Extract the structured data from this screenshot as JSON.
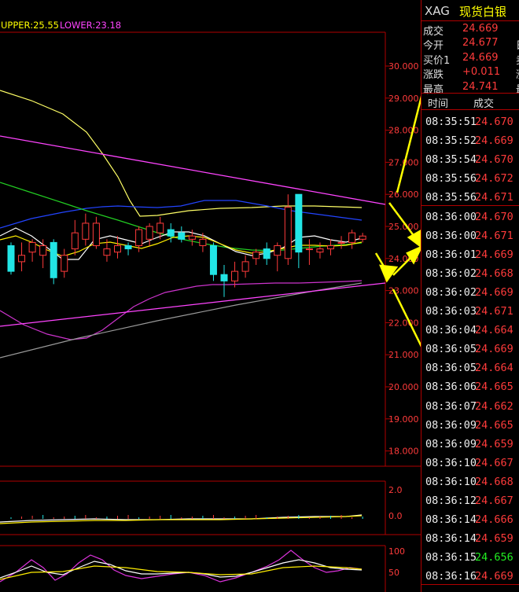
{
  "indicator_legend": {
    "upper": "UPPER:25.55",
    "lower": "LOWER:23.18"
  },
  "price_axis": [
    "30.000",
    "29.000",
    "28.000",
    "27.000",
    "26.000",
    "25.000",
    "24.000",
    "23.000",
    "22.000",
    "21.000",
    "20.000",
    "19.000",
    "18.000"
  ],
  "sub1_axis": [
    "2.0",
    "0.0"
  ],
  "sub2_axis": [
    "100",
    "50"
  ],
  "header": {
    "code": "XAG",
    "name": "现货白银"
  },
  "quote_rows": [
    {
      "label": "成交",
      "value": "24.669",
      "extra": ""
    },
    {
      "label": "今开",
      "value": "24.677",
      "extra": "日"
    },
    {
      "label": "买价1",
      "value": "24.669",
      "extra": "卖"
    },
    {
      "label": "涨跌",
      "value": "+0.011",
      "extra": "涨"
    },
    {
      "label": "最高",
      "value": "24.741",
      "extra": "最"
    }
  ],
  "tick_header": {
    "time": "时间",
    "price": "成交"
  },
  "ticks": [
    {
      "time": "08:35:51",
      "price": "24.670",
      "color": "red"
    },
    {
      "time": "08:35:52",
      "price": "24.669",
      "color": "red"
    },
    {
      "time": "08:35:54",
      "price": "24.670",
      "color": "red"
    },
    {
      "time": "08:35:56",
      "price": "24.672",
      "color": "red"
    },
    {
      "time": "08:35:56",
      "price": "24.671",
      "color": "red"
    },
    {
      "time": "08:36:00",
      "price": "24.670",
      "color": "red"
    },
    {
      "time": "08:36:00",
      "price": "24.671",
      "color": "red"
    },
    {
      "time": "08:36:01",
      "price": "24.669",
      "color": "red"
    },
    {
      "time": "08:36:02",
      "price": "24.668",
      "color": "red"
    },
    {
      "time": "08:36:02",
      "price": "24.669",
      "color": "red"
    },
    {
      "time": "08:36:03",
      "price": "24.671",
      "color": "red"
    },
    {
      "time": "08:36:04",
      "price": "24.664",
      "color": "red"
    },
    {
      "time": "08:36:05",
      "price": "24.669",
      "color": "red"
    },
    {
      "time": "08:36:05",
      "price": "24.664",
      "color": "red"
    },
    {
      "time": "08:36:06",
      "price": "24.665",
      "color": "red"
    },
    {
      "time": "08:36:07",
      "price": "24.662",
      "color": "red"
    },
    {
      "time": "08:36:09",
      "price": "24.665",
      "color": "red"
    },
    {
      "time": "08:36:09",
      "price": "24.659",
      "color": "red"
    },
    {
      "time": "08:36:10",
      "price": "24.667",
      "color": "red"
    },
    {
      "time": "08:36:10",
      "price": "24.668",
      "color": "red"
    },
    {
      "time": "08:36:12",
      "price": "24.667",
      "color": "red"
    },
    {
      "time": "08:36:14",
      "price": "24.666",
      "color": "red"
    },
    {
      "time": "08:36:14",
      "price": "24.659",
      "color": "red"
    },
    {
      "time": "08:36:15",
      "price": "24.656",
      "color": "green"
    },
    {
      "time": "08:36:16",
      "price": "24.669",
      "color": "red"
    }
  ],
  "chart_data": {
    "type": "candlestick",
    "y_range": [
      17.5,
      30.5
    ],
    "candles": [
      {
        "o": 23.6,
        "c": 24.4,
        "h": 24.5,
        "l": 23.5,
        "up": false
      },
      {
        "o": 23.9,
        "c": 24.1,
        "h": 24.5,
        "l": 23.6,
        "up": true
      },
      {
        "o": 24.2,
        "c": 24.5,
        "h": 24.6,
        "l": 23.9,
        "up": true
      },
      {
        "o": 24.1,
        "c": 24.4,
        "h": 24.6,
        "l": 23.7,
        "up": true
      },
      {
        "o": 23.4,
        "c": 24.5,
        "h": 24.6,
        "l": 23.2,
        "up": false
      },
      {
        "o": 23.6,
        "c": 24.1,
        "h": 24.3,
        "l": 23.4,
        "up": true
      },
      {
        "o": 24.3,
        "c": 24.8,
        "h": 25.2,
        "l": 24.1,
        "up": true
      },
      {
        "o": 24.6,
        "c": 25.1,
        "h": 25.4,
        "l": 24.4,
        "up": true
      },
      {
        "o": 25.1,
        "c": 24.4,
        "h": 25.3,
        "l": 24.3,
        "up": true
      },
      {
        "o": 24.3,
        "c": 24.1,
        "h": 24.6,
        "l": 23.9,
        "up": true
      },
      {
        "o": 24.4,
        "c": 24.2,
        "h": 24.7,
        "l": 24.0,
        "up": true
      },
      {
        "o": 24.3,
        "c": 24.4,
        "h": 24.5,
        "l": 24.1,
        "up": false
      },
      {
        "o": 24.4,
        "c": 24.9,
        "h": 25.0,
        "l": 24.2,
        "up": true
      },
      {
        "o": 24.6,
        "c": 25.0,
        "h": 25.1,
        "l": 24.4,
        "up": true
      },
      {
        "o": 24.8,
        "c": 25.1,
        "h": 25.3,
        "l": 24.6,
        "up": true
      },
      {
        "o": 24.9,
        "c": 24.7,
        "h": 25.1,
        "l": 24.5,
        "up": false
      },
      {
        "o": 24.8,
        "c": 24.6,
        "h": 25.0,
        "l": 24.5,
        "up": false
      },
      {
        "o": 24.6,
        "c": 24.7,
        "h": 24.9,
        "l": 24.4,
        "up": true
      },
      {
        "o": 24.6,
        "c": 24.4,
        "h": 24.8,
        "l": 24.2,
        "up": true
      },
      {
        "o": 24.4,
        "c": 23.5,
        "h": 24.5,
        "l": 23.3,
        "up": false
      },
      {
        "o": 23.5,
        "c": 23.3,
        "h": 23.8,
        "l": 22.8,
        "up": false
      },
      {
        "o": 23.6,
        "c": 23.3,
        "h": 23.9,
        "l": 23.1,
        "up": true
      },
      {
        "o": 23.6,
        "c": 23.9,
        "h": 24.1,
        "l": 23.4,
        "up": true
      },
      {
        "o": 24.0,
        "c": 24.2,
        "h": 24.3,
        "l": 23.8,
        "up": true
      },
      {
        "o": 24.0,
        "c": 24.3,
        "h": 24.5,
        "l": 23.8,
        "up": false
      },
      {
        "o": 24.4,
        "c": 24.1,
        "h": 24.5,
        "l": 23.6,
        "up": true
      },
      {
        "o": 24.0,
        "c": 25.6,
        "h": 26.0,
        "l": 23.8,
        "up": true
      },
      {
        "o": 24.2,
        "c": 26.0,
        "h": 26.0,
        "l": 23.7,
        "up": false
      },
      {
        "o": 24.3,
        "c": 24.3,
        "h": 24.6,
        "l": 23.8,
        "up": true
      },
      {
        "o": 24.2,
        "c": 24.3,
        "h": 24.5,
        "l": 24.0,
        "up": true
      },
      {
        "o": 24.4,
        "c": 24.3,
        "h": 24.6,
        "l": 24.1,
        "up": true
      },
      {
        "o": 24.5,
        "c": 24.5,
        "h": 24.7,
        "l": 24.3,
        "up": true
      },
      {
        "o": 24.5,
        "c": 24.8,
        "h": 24.9,
        "l": 24.3,
        "up": true
      },
      {
        "o": 24.6,
        "c": 24.7,
        "h": 24.8,
        "l": 24.5,
        "up": true
      }
    ]
  }
}
